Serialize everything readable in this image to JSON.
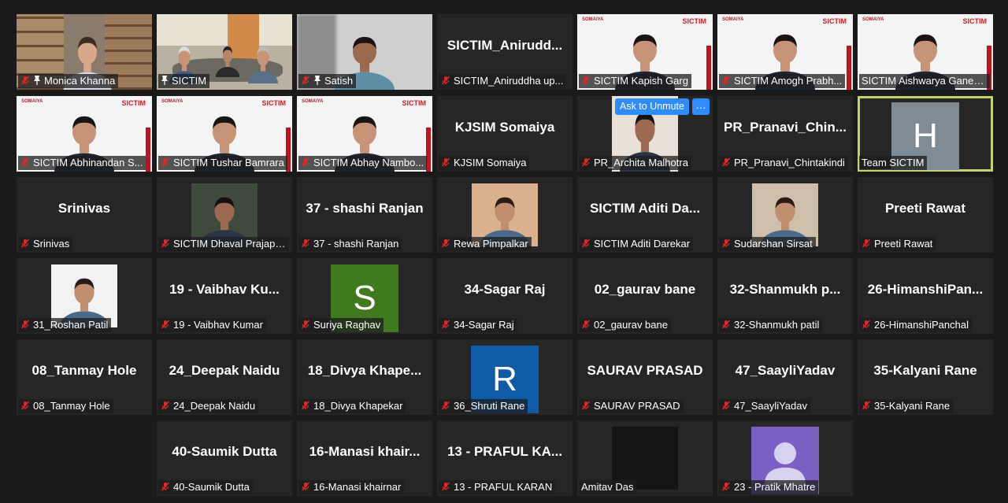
{
  "colors": {
    "muted_mic": "#e02828",
    "active_border": "#c4d46c",
    "button_blue": "#2d8cff"
  },
  "tiles": [
    {
      "label": "Monica Khanna",
      "big": "",
      "muted": true,
      "pinned": true
    },
    {
      "label": "SICTIM",
      "big": "",
      "muted": false,
      "pinned": true
    },
    {
      "label": "Satish",
      "big": "",
      "muted": true,
      "pinned": true
    },
    {
      "label": "SICTIM_Aniruddha up...",
      "big": "SICTIM_Anirudd...",
      "muted": true
    },
    {
      "label": "SICTIM Kapish Garg",
      "big": "",
      "muted": true
    },
    {
      "label": "SICTIM Amogh Prabh...",
      "big": "",
      "muted": true
    },
    {
      "label": "SICTIM Aishwarya Ganes...",
      "big": "",
      "muted": false
    },
    {
      "label": "SICTIM Abhinandan S...",
      "big": "",
      "muted": true
    },
    {
      "label": "SICTIM Tushar Bamrara",
      "big": "",
      "muted": true
    },
    {
      "label": "SICTIM Abhay Nambo...",
      "big": "",
      "muted": true
    },
    {
      "label": "KJSIM Somaiya",
      "big": "KJSIM Somaiya",
      "muted": true
    },
    {
      "label": "PR_Archita Malhotra",
      "big": "",
      "muted": true
    },
    {
      "label": "PR_Pranavi_Chintakindi",
      "big": "PR_Pranavi_Chin...",
      "muted": true
    },
    {
      "label": "Team SICTIM",
      "big": "",
      "muted": false,
      "avatar": "H"
    },
    {
      "label": "Srinivas",
      "big": "Srinivas",
      "muted": true
    },
    {
      "label": "SICTIM Dhaval Prajapati",
      "big": "",
      "muted": true
    },
    {
      "label": "37 - shashi Ranjan",
      "big": "37 - shashi Ranjan",
      "muted": true
    },
    {
      "label": "Rewa Pimpalkar",
      "big": "",
      "muted": true
    },
    {
      "label": "SICTIM Aditi Darekar",
      "big": "SICTIM Aditi Da...",
      "muted": true
    },
    {
      "label": "Sudarshan Sirsat",
      "big": "",
      "muted": true
    },
    {
      "label": "Preeti Rawat",
      "big": "Preeti Rawat",
      "muted": true
    },
    {
      "label": "31_Roshan Patil",
      "big": "",
      "muted": true
    },
    {
      "label": "19 - Vaibhav Kumar",
      "big": "19 - Vaibhav Ku...",
      "muted": true
    },
    {
      "label": "Suriya Raghav",
      "big": "",
      "muted": true,
      "avatar": "S"
    },
    {
      "label": "34-Sagar Raj",
      "big": "34-Sagar Raj",
      "muted": true
    },
    {
      "label": "02_gaurav bane",
      "big": "02_gaurav bane",
      "muted": true
    },
    {
      "label": "32-Shanmukh patil",
      "big": "32-Shanmukh p...",
      "muted": true
    },
    {
      "label": "26-HimanshiPanchal",
      "big": "26-HimanshiPan...",
      "muted": true
    },
    {
      "label": "08_Tanmay Hole",
      "big": "08_Tanmay Hole",
      "muted": true
    },
    {
      "label": "24_Deepak Naidu",
      "big": "24_Deepak Naidu",
      "muted": true
    },
    {
      "label": "18_Divya Khapekar",
      "big": "18_Divya Khape...",
      "muted": true
    },
    {
      "label": "36_Shruti Rane",
      "big": "",
      "muted": true,
      "avatar": "R"
    },
    {
      "label": "SAURAV PRASAD",
      "big": "SAURAV PRASAD",
      "muted": true
    },
    {
      "label": "47_SaayliYadav",
      "big": "47_SaayliYadav",
      "muted": true
    },
    {
      "label": "35-Kalyani Rane",
      "big": "35-Kalyani Rane",
      "muted": true
    },
    {
      "label": "40-Saumik Dutta",
      "big": "40-Saumik Dutta",
      "muted": true
    },
    {
      "label": "16-Manasi khairnar",
      "big": "16-Manasi khair...",
      "muted": true
    },
    {
      "label": "13 - PRAFUL KARAN",
      "big": "13 - PRAFUL KA...",
      "muted": true
    },
    {
      "label": "Amitav Das",
      "big": "",
      "muted": false
    },
    {
      "label": "23 - Pratik Mhatre",
      "big": "",
      "muted": true
    }
  ],
  "ask_unmute": {
    "label": "Ask to Unmute",
    "more": "…"
  },
  "sictim_logo": "SICTIM",
  "somaiya_logo": "SOMAIYA"
}
